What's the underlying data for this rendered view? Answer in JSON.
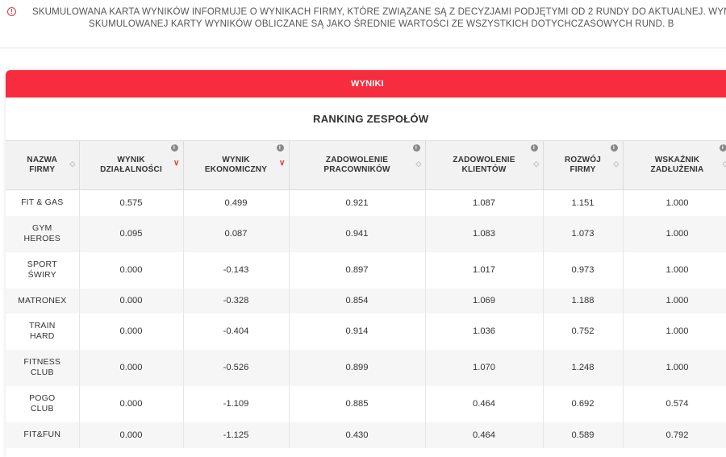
{
  "info": {
    "line1": "SKUMULOWANA KARTA WYNIKÓW INFORMUJE O WYNIKACH FIRMY, KTÓRE ZWIĄZANE SĄ Z DECYZJAMI PODJĘTYMI OD 2 RUNDY DO AKTUALNEJ. WYNIKI ZE",
    "line2": "SKUMULOWANEJ KARTY WYNIKÓW OBLICZANE SĄ JAKO ŚREDNIE WARTOŚCI ZE WSZYSTKICH DOTYCHCZASOWYCH RUND. B"
  },
  "card": {
    "header": "WYNIKI",
    "ranking_title": "RANKING ZESPOŁÓW"
  },
  "table": {
    "columns": [
      {
        "label_lines": [
          "NAZWA",
          "FIRMY"
        ],
        "info": false,
        "sort": "none"
      },
      {
        "label_lines": [
          "WYNIK",
          "DZIAŁALNOŚCI"
        ],
        "info": true,
        "sort": "desc"
      },
      {
        "label_lines": [
          "WYNIK",
          "EKONOMICZNY"
        ],
        "info": true,
        "sort": "desc"
      },
      {
        "label_lines": [
          "ZADOWOLENIE",
          "PRACOWNIKÓW"
        ],
        "info": true,
        "sort": "none"
      },
      {
        "label_lines": [
          "ZADOWOLENIE",
          "KLIENTÓW"
        ],
        "info": true,
        "sort": "none"
      },
      {
        "label_lines": [
          "ROZWÓJ",
          "FIRMY"
        ],
        "info": true,
        "sort": "none"
      },
      {
        "label_lines": [
          "WSKAŹNIK",
          "ZADŁUŻENIA"
        ],
        "info": true,
        "sort": "none"
      }
    ],
    "rows": [
      {
        "name_lines": [
          "FIT & GAS"
        ],
        "values": [
          "0.575",
          "0.499",
          "0.921",
          "1.087",
          "1.151",
          "1.000"
        ]
      },
      {
        "name_lines": [
          "GYM",
          "HEROES"
        ],
        "values": [
          "0.095",
          "0.087",
          "0.941",
          "1.083",
          "1.073",
          "1.000"
        ]
      },
      {
        "name_lines": [
          "SPORT",
          "ŚWIRY"
        ],
        "values": [
          "0.000",
          "-0.143",
          "0.897",
          "1.017",
          "0.973",
          "1.000"
        ]
      },
      {
        "name_lines": [
          "MATRONEX"
        ],
        "values": [
          "0.000",
          "-0.328",
          "0.854",
          "1.069",
          "1.188",
          "1.000"
        ]
      },
      {
        "name_lines": [
          "TRAIN",
          "HARD"
        ],
        "values": [
          "0.000",
          "-0.404",
          "0.914",
          "1.036",
          "0.752",
          "1.000"
        ]
      },
      {
        "name_lines": [
          "FITNESS",
          "CLUB"
        ],
        "values": [
          "0.000",
          "-0.526",
          "0.899",
          "1.070",
          "1.248",
          "1.000"
        ]
      },
      {
        "name_lines": [
          "POGO",
          "CLUB"
        ],
        "values": [
          "0.000",
          "-1.109",
          "0.885",
          "0.464",
          "0.692",
          "0.574"
        ]
      },
      {
        "name_lines": [
          "FIT&FUN"
        ],
        "values": [
          "0.000",
          "-1.125",
          "0.430",
          "0.464",
          "0.589",
          "0.792"
        ]
      }
    ]
  },
  "icons": {
    "info_banner": "info-circle-icon",
    "column_info": "info-icon",
    "sort_inactive": "sort-icon",
    "sort_active": "sort-desc-icon"
  },
  "colors": {
    "accent": "#f72d3f",
    "info": "#e03a45"
  }
}
